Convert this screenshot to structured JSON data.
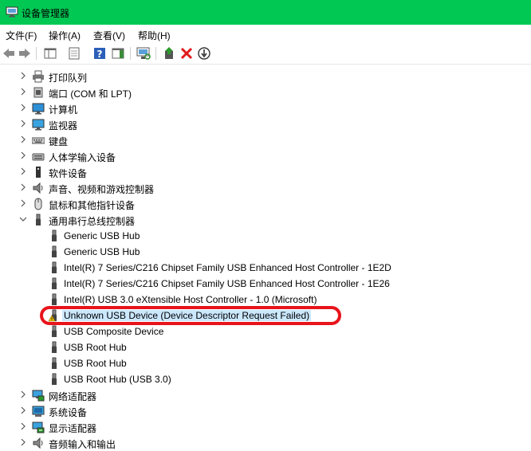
{
  "window": {
    "title": "设备管理器"
  },
  "menu": [
    "文件(F)",
    "操作(A)",
    "查看(V)",
    "帮助(H)"
  ],
  "toolbar_icons": [
    "back-icon",
    "forward-icon",
    "show-hide-console-tree-icon",
    "properties-icon",
    "help-icon",
    "action-pane-icon",
    "scan-hardware-icon",
    "update-driver-icon",
    "uninstall-device-icon",
    "disable-device-icon"
  ],
  "tree": {
    "categories_top": [
      {
        "label": "打印队列",
        "icon": "printer-icon"
      },
      {
        "label": "端口 (COM 和 LPT)",
        "icon": "port-icon"
      },
      {
        "label": "计算机",
        "icon": "computer-icon"
      },
      {
        "label": "监视器",
        "icon": "monitor-icon"
      },
      {
        "label": "键盘",
        "icon": "keyboard-icon"
      },
      {
        "label": "人体学输入设备",
        "icon": "hid-icon"
      },
      {
        "label": "软件设备",
        "icon": "software-device-icon"
      },
      {
        "label": "声音、视频和游戏控制器",
        "icon": "speaker-icon"
      },
      {
        "label": "鼠标和其他指针设备",
        "icon": "mouse-icon"
      }
    ],
    "usb_category": {
      "label": "通用串行总线控制器",
      "icon": "usb-icon"
    },
    "usb_children": [
      {
        "label": "Generic USB Hub"
      },
      {
        "label": "Generic USB Hub"
      },
      {
        "label": "Intel(R) 7 Series/C216 Chipset Family USB Enhanced Host Controller - 1E2D"
      },
      {
        "label": "Intel(R) 7 Series/C216 Chipset Family USB Enhanced Host Controller - 1E26"
      },
      {
        "label": "Intel(R) USB 3.0 eXtensible Host Controller - 1.0 (Microsoft)"
      },
      {
        "label": "Unknown USB Device (Device Descriptor Request Failed)",
        "warning": true,
        "selected": true
      },
      {
        "label": "USB Composite Device"
      },
      {
        "label": "USB Root Hub"
      },
      {
        "label": "USB Root Hub"
      },
      {
        "label": "USB Root Hub (USB 3.0)"
      }
    ],
    "categories_bottom": [
      {
        "label": "网络适配器",
        "icon": "network-adapter-icon"
      },
      {
        "label": "系统设备",
        "icon": "system-device-icon"
      },
      {
        "label": "显示适配器",
        "icon": "display-adapter-icon"
      },
      {
        "label": "音频输入和输出",
        "icon": "audio-io-icon"
      }
    ]
  },
  "colors": {
    "titlebar": "#00c853",
    "selection": "#cce8ff",
    "annotation": "#e8141b"
  }
}
